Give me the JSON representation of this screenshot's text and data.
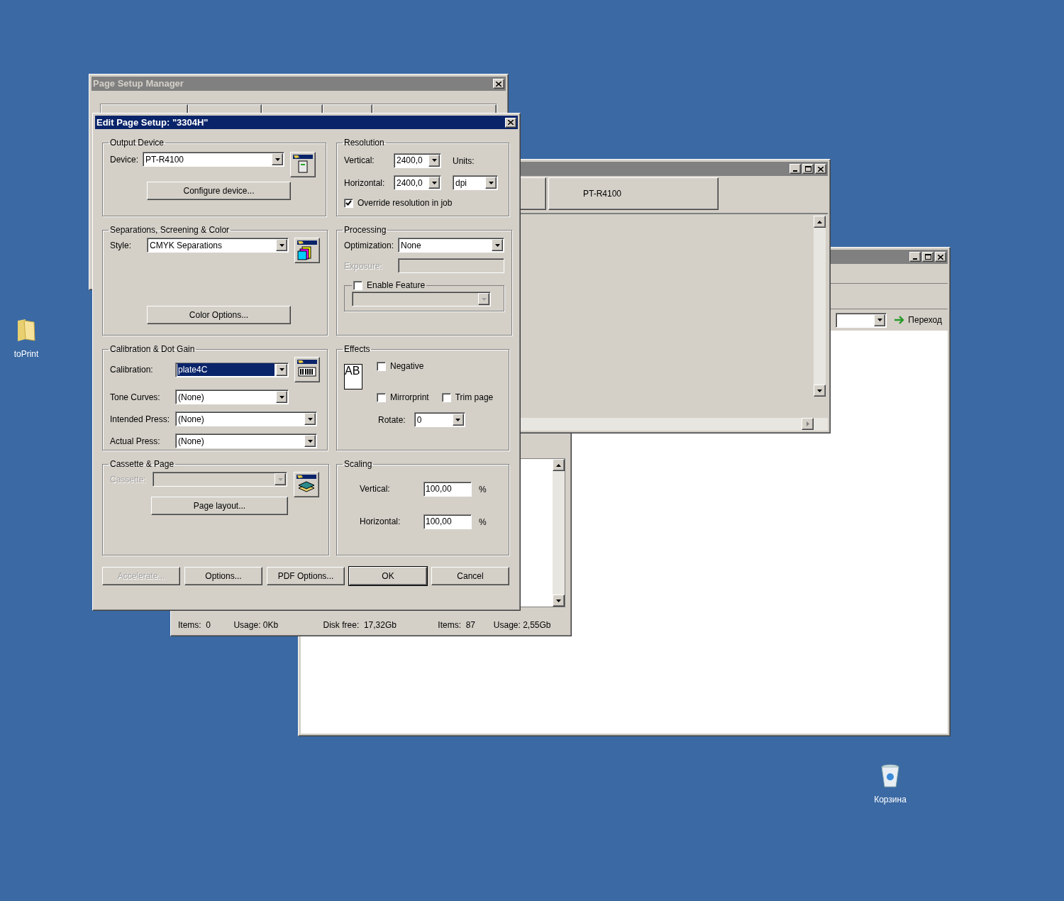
{
  "desktop_icons": [
    {
      "kind": "folder",
      "label": "toPrint"
    },
    {
      "kind": "recycle_bin",
      "label": "Корзина"
    }
  ],
  "explorer_window": {
    "go_button": "Переход"
  },
  "file_manager_window": {
    "status": [
      "Items:  0",
      "Usage: 0Kb",
      "Disk free:  17,32Gb",
      "Items:  87",
      "Usage: 2,55Gb"
    ]
  },
  "device_window": {
    "cells": [
      "PT-R4100"
    ]
  },
  "page_setup_manager": {
    "title": "Page Setup Manager"
  },
  "edit_dialog": {
    "title": "Edit Page Setup: \"3304H\"",
    "output_device": {
      "legend": "Output Device",
      "device_label": "Device:",
      "device_value": "PT-R4100",
      "configure_button": "Configure device..."
    },
    "separations": {
      "legend": "Separations, Screening & Color",
      "style_label": "Style:",
      "style_value": "CMYK Separations",
      "color_options_button": "Color Options..."
    },
    "calibration": {
      "legend": "Calibration & Dot Gain",
      "rows": [
        {
          "label": "Calibration:",
          "value": "plate4C",
          "highlighted": true
        },
        {
          "label": "Tone Curves:",
          "value": "(None)",
          "highlighted": false
        },
        {
          "label": "Intended Press:",
          "value": "(None)",
          "highlighted": false
        },
        {
          "label": "Actual Press:",
          "value": "(None)",
          "highlighted": false
        }
      ]
    },
    "cassette": {
      "legend": "Cassette & Page",
      "cassette_label": "Cassette:",
      "disabled": true,
      "page_layout_button": "Page layout..."
    },
    "resolution": {
      "legend": "Resolution",
      "vertical_label": "Vertical:",
      "vertical_value": "2400,0",
      "horizontal_label": "Horizontal:",
      "horizontal_value": "2400,0",
      "units_label": "Units:",
      "units_value": "dpi",
      "override": {
        "label": "Override resolution in job",
        "checked": true
      }
    },
    "processing": {
      "legend": "Processing",
      "optimization_label": "Optimization:",
      "optimization_value": "None",
      "exposure_label": "Exposure:",
      "exposure_disabled": true,
      "enable_feature": {
        "label": "Enable Feature",
        "checked": false
      }
    },
    "effects": {
      "legend": "Effects",
      "preview_text": "AB",
      "negative": {
        "label": "Negative",
        "checked": false
      },
      "mirrorprint": {
        "label": "Mirrorprint",
        "checked": false
      },
      "trim_page": {
        "label": "Trim page",
        "checked": false
      },
      "rotate_label": "Rotate:",
      "rotate_value": "0"
    },
    "scaling": {
      "legend": "Scaling",
      "vertical_label": "Vertical:",
      "vertical_value": "100,00",
      "vertical_unit": "%",
      "horizontal_label": "Horizontal:",
      "horizontal_value": "100,00",
      "horizontal_unit": "%"
    },
    "buttons": [
      {
        "label": "Accelerate...",
        "disabled": true,
        "default": false
      },
      {
        "label": "Options...",
        "disabled": false,
        "default": false
      },
      {
        "label": "PDF Options...",
        "disabled": false,
        "default": false
      },
      {
        "label": "OK",
        "disabled": false,
        "default": true
      },
      {
        "label": "Cancel",
        "disabled": false,
        "default": false
      }
    ]
  }
}
